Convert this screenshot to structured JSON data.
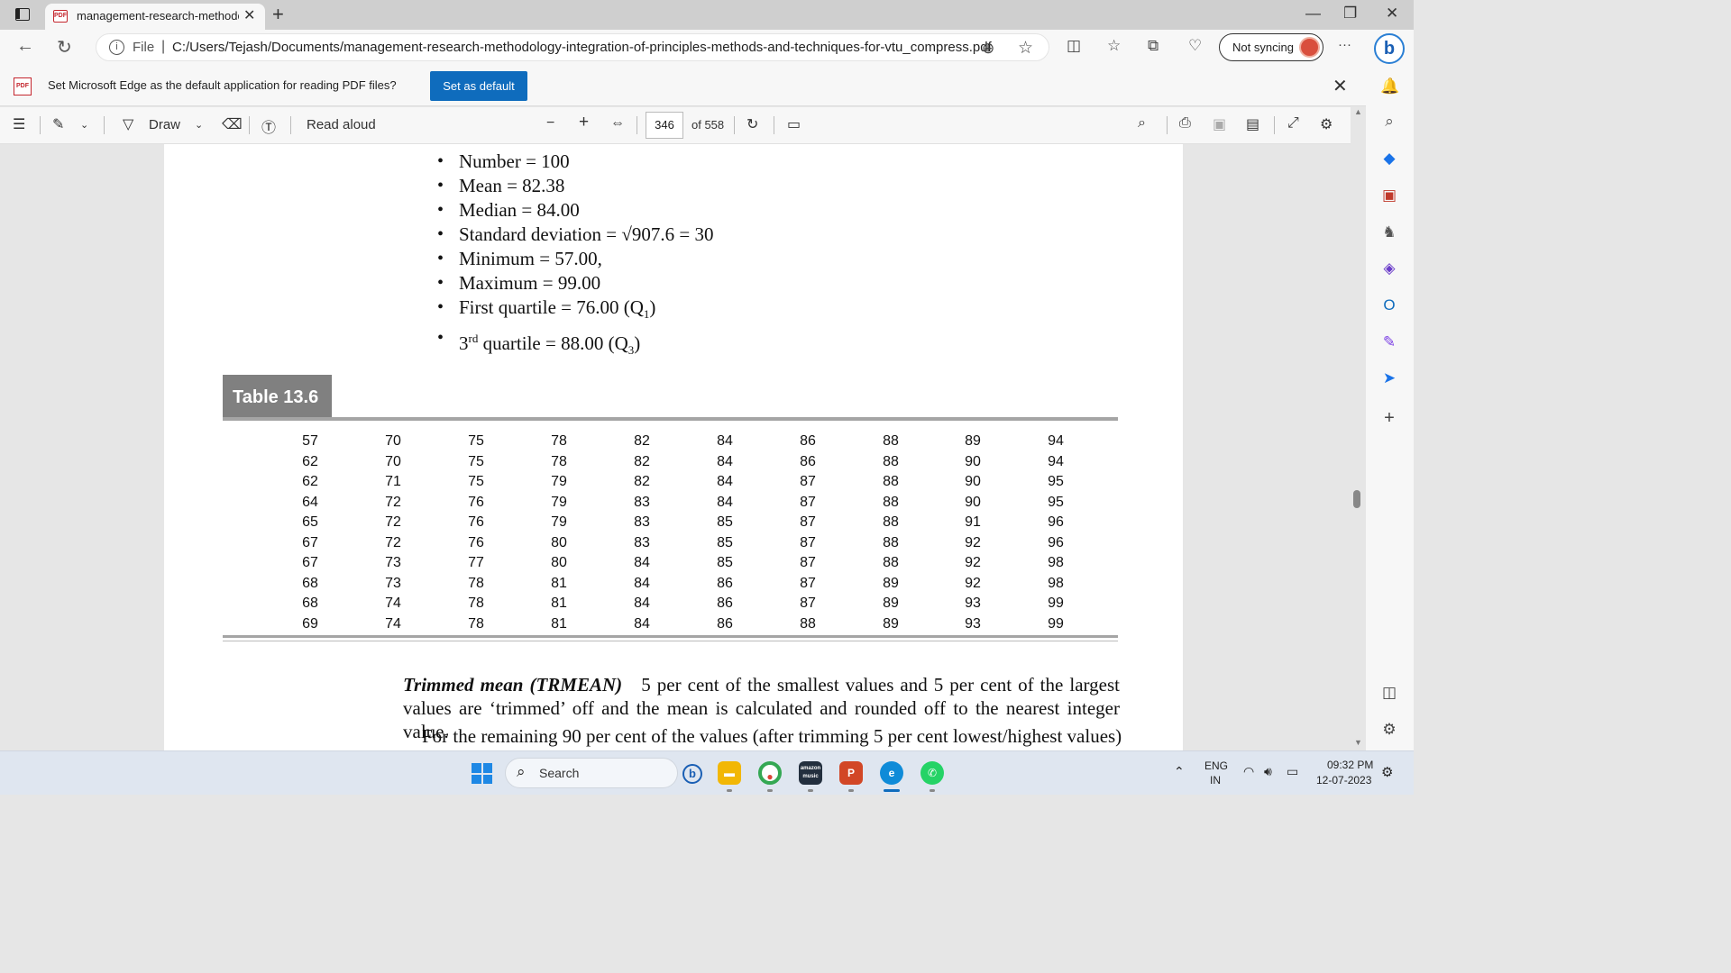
{
  "browser": {
    "tab_title": "management-research-methodo",
    "tab_close": "✕",
    "new_tab": "+",
    "address_prefix": "File",
    "url": "C:/Users/Tejash/Documents/management-research-methodology-integration-of-principles-methods-and-techniques-for-vtu_compress.pdf",
    "sync_label": "Not syncing",
    "more_label": "···"
  },
  "infobar": {
    "message": "Set Microsoft Edge as the default application for reading PDF files?",
    "button": "Set as default",
    "pdf_badge": "PDF"
  },
  "pdf_toolbar": {
    "draw_label": "Draw",
    "read_aloud_label": "Read aloud",
    "page_number": "346",
    "page_total": "of 558"
  },
  "document": {
    "bullets": [
      {
        "text": "Number = 100"
      },
      {
        "text": "Mean = 82.38"
      },
      {
        "text": "Median = 84.00"
      },
      {
        "text": "Standard deviation = √907.6 = 30"
      },
      {
        "text": "Minimum = 57.00,"
      },
      {
        "text": "Maximum = 99.00"
      },
      {
        "text": "First quartile = 76.00 (Q",
        "sub": "1",
        "tail": ")"
      },
      {
        "text": "3",
        "sup": "rd",
        "tail2": " quartile = 88.00 (Q",
        "sub": "3",
        "tail": ")"
      }
    ],
    "table_label": "Table 13.6",
    "table_columns": [
      [
        "57",
        "62",
        "62",
        "64",
        "65",
        "67",
        "67",
        "68",
        "68",
        "69"
      ],
      [
        "70",
        "70",
        "71",
        "72",
        "72",
        "72",
        "73",
        "73",
        "74",
        "74"
      ],
      [
        "75",
        "75",
        "75",
        "76",
        "76",
        "76",
        "77",
        "78",
        "78",
        "78"
      ],
      [
        "78",
        "78",
        "79",
        "79",
        "79",
        "80",
        "80",
        "81",
        "81",
        "81"
      ],
      [
        "82",
        "82",
        "82",
        "83",
        "83",
        "83",
        "84",
        "84",
        "84",
        "84"
      ],
      [
        "84",
        "84",
        "84",
        "84",
        "85",
        "85",
        "85",
        "86",
        "86",
        "86"
      ],
      [
        "86",
        "86",
        "87",
        "87",
        "87",
        "87",
        "87",
        "87",
        "87",
        "88"
      ],
      [
        "88",
        "88",
        "88",
        "88",
        "88",
        "88",
        "88",
        "89",
        "89",
        "89"
      ],
      [
        "89",
        "90",
        "90",
        "90",
        "91",
        "92",
        "92",
        "92",
        "93",
        "93"
      ],
      [
        "94",
        "94",
        "95",
        "95",
        "96",
        "96",
        "98",
        "98",
        "99",
        "99"
      ]
    ],
    "para1_term": "Trimmed mean (TRMEAN)",
    "para1_text": "5 per cent of the smallest values and 5 per cent of the largest values are ‘trimmed’ off and the mean is calculated and rounded off to the nearest integer value.",
    "para2_text": "For the remaining 90 per cent of the values (after trimming 5 per cent lowest/highest values)"
  },
  "taskbar": {
    "search_label": "Search",
    "lang_line1": "ENG",
    "lang_line2": "IN",
    "time": "09:32 PM",
    "date": "12-07-2023",
    "amazon_music_label": "amazon music"
  }
}
